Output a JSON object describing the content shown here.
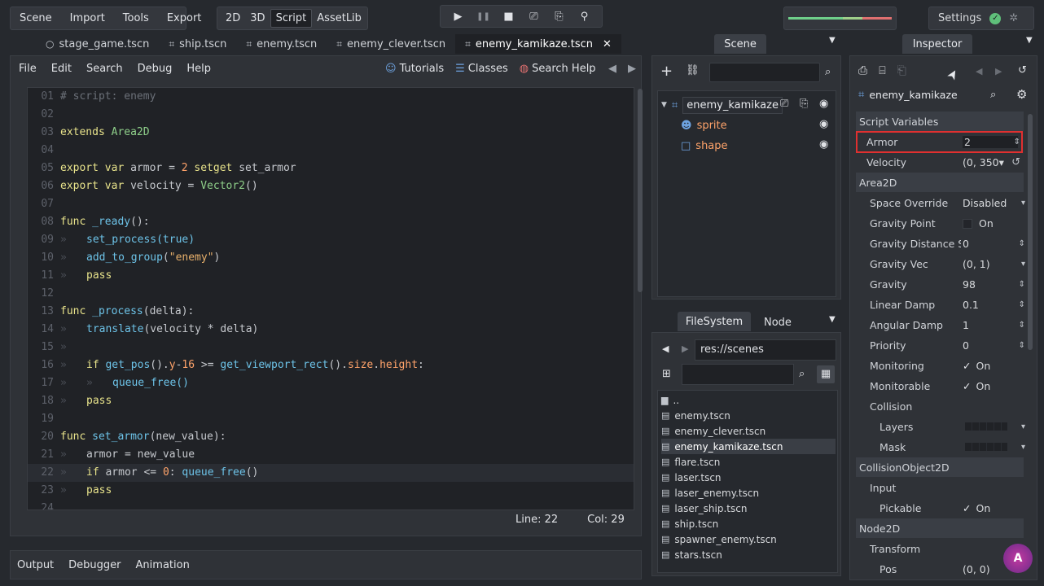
{
  "top_menu": [
    "Scene",
    "Import",
    "Tools",
    "Export"
  ],
  "modes": {
    "items": [
      "2D",
      "3D",
      "Script",
      "AssetLib"
    ],
    "active": "Script"
  },
  "play": {
    "play": "▶",
    "pause": "❚❚",
    "stop": "■",
    "scene": "⎚",
    "custom": "⎘",
    "remote": "⚲"
  },
  "settings": {
    "label": "Settings",
    "status_icon": "✓",
    "spinner": "✲"
  },
  "tabs": [
    {
      "label": "stage_game.tscn",
      "icon": "○"
    },
    {
      "label": "ship.tscn",
      "icon": "⌗"
    },
    {
      "label": "enemy.tscn",
      "icon": "⌗"
    },
    {
      "label": "enemy_clever.tscn",
      "icon": "⌗"
    },
    {
      "label": "enemy_kamikaze.tscn",
      "icon": "⌗",
      "close": "✕"
    }
  ],
  "script_menu": [
    "File",
    "Edit",
    "Search",
    "Debug",
    "Help"
  ],
  "script_help": [
    {
      "label": "Tutorials",
      "icon": "☺"
    },
    {
      "label": "Classes",
      "icon": "☰"
    },
    {
      "label": "Search Help",
      "icon": "◍"
    }
  ],
  "script_nav": {
    "prev": "◀",
    "next": "▶"
  },
  "code": {
    "gutter": "»",
    "lines": [
      {
        "num": "01",
        "text": "# script: enemy"
      },
      {
        "num": "02",
        "text": ""
      },
      {
        "num": "03",
        "text": "extends Area2D"
      },
      {
        "num": "04",
        "text": ""
      },
      {
        "num": "05",
        "text": "export var armor = 2 setget set_armor"
      },
      {
        "num": "06",
        "text": "export var velocity = Vector2()"
      },
      {
        "num": "07",
        "text": ""
      },
      {
        "num": "08",
        "text": "func _ready():"
      },
      {
        "num": "09",
        "text": "set_process(true)"
      },
      {
        "num": "10",
        "text": "add_to_group(\"enemy\")"
      },
      {
        "num": "11",
        "text": "pass"
      },
      {
        "num": "12",
        "text": ""
      },
      {
        "num": "13",
        "text": "func _process(delta):"
      },
      {
        "num": "14",
        "text": "translate(velocity * delta)"
      },
      {
        "num": "15",
        "text": ""
      },
      {
        "num": "16",
        "text": "if get_pos().y-16 >= get_viewport_rect().size.height:"
      },
      {
        "num": "17",
        "text": "queue_free()"
      },
      {
        "num": "18",
        "text": "pass"
      },
      {
        "num": "19",
        "text": ""
      },
      {
        "num": "20",
        "text": "func set_armor(new_value):"
      },
      {
        "num": "21",
        "text": "armor = new_value"
      },
      {
        "num": "22",
        "text": "if armor <= 0: queue_free()"
      },
      {
        "num": "23",
        "text": "pass"
      },
      {
        "num": "24",
        "text": ""
      }
    ]
  },
  "status": {
    "line": "Line: 22",
    "col": "Col: 29"
  },
  "bottom_tabs": [
    "Output",
    "Debugger",
    "Animation"
  ],
  "scene_dock": {
    "tab": "Scene",
    "add": "+",
    "link": "⛓",
    "search": "⌕",
    "root": {
      "name": "enemy_kamikaze",
      "icon": "⌗",
      "extra1": "⎚",
      "extra2": "⎘",
      "eye": "◉"
    },
    "children": [
      {
        "name": "sprite",
        "icon": "☻",
        "eye": "◉"
      },
      {
        "name": "shape",
        "icon": "□",
        "eye": "◉"
      }
    ]
  },
  "fs_dock": {
    "tabs": [
      "FileSystem",
      "Node"
    ],
    "path": "res://scenes",
    "back": "◀",
    "fwd": "▶",
    "tree_icon": "⊞",
    "search": "⌕",
    "grid_icon": "▦",
    "files": [
      "..",
      "enemy.tscn",
      "enemy_clever.tscn",
      "enemy_kamikaze.tscn",
      "flare.tscn",
      "laser.tscn",
      "laser_enemy.tscn",
      "laser_ship.tscn",
      "ship.tscn",
      "spawner_enemy.tscn",
      "stars.tscn"
    ],
    "selected": "enemy_kamikaze.tscn"
  },
  "inspector": {
    "tab": "Inspector",
    "tools": {
      "new": "⎙",
      "open": "⌸",
      "save": "⎗",
      "prev": "◀",
      "next": "▶",
      "history": "↺"
    },
    "object": "enemy_kamikaze",
    "object_icon": "⌗",
    "search": "⌕",
    "gear": "⚙",
    "sections": {
      "script_vars": "Script Variables",
      "area2d": "Area2D",
      "collision_obj": "CollisionObject2D",
      "node2d": "Node2D"
    },
    "props": {
      "armor": {
        "k": "Armor",
        "v": "2",
        "a": "⇕"
      },
      "velocity": {
        "k": "Velocity",
        "v": "(0, 350▾",
        "a": "↺"
      },
      "space_override": {
        "k": "Space Override",
        "v": "Disabled",
        "a": "▾"
      },
      "gravity_point": {
        "k": "Gravity Point",
        "v": "On"
      },
      "gravity_distance": {
        "k": "Gravity Distance Sc",
        "v": "0",
        "a": "⇕"
      },
      "gravity_vec": {
        "k": "Gravity Vec",
        "v": "(0, 1)",
        "a": "▾"
      },
      "gravity": {
        "k": "Gravity",
        "v": "98",
        "a": "⇕"
      },
      "linear_damp": {
        "k": "Linear Damp",
        "v": "0.1",
        "a": "⇕"
      },
      "angular_damp": {
        "k": "Angular Damp",
        "v": "1",
        "a": "⇕"
      },
      "priority": {
        "k": "Priority",
        "v": "0",
        "a": "⇕"
      },
      "monitoring": {
        "k": "Monitoring",
        "v": "On",
        "check": "✓"
      },
      "monitorable": {
        "k": "Monitorable",
        "v": "On",
        "check": "✓"
      },
      "collision": {
        "k": "Collision"
      },
      "layers": {
        "k": "Layers",
        "a": "▾"
      },
      "mask": {
        "k": "Mask",
        "a": "▾"
      },
      "input": {
        "k": "Input"
      },
      "pickable": {
        "k": "Pickable",
        "v": "On",
        "check": "✓"
      },
      "transform": {
        "k": "Transform"
      },
      "pos": {
        "k": "Pos",
        "v": "(0, 0)"
      }
    },
    "logo": "A"
  },
  "pointer": "➤",
  "colors": {
    "accent": "#6ea3e0",
    "highlight_box": "#e03030",
    "keyword": "#e8e38b",
    "type": "#8fd08a",
    "number": "#ffa36a",
    "function": "#6dc3e8"
  }
}
